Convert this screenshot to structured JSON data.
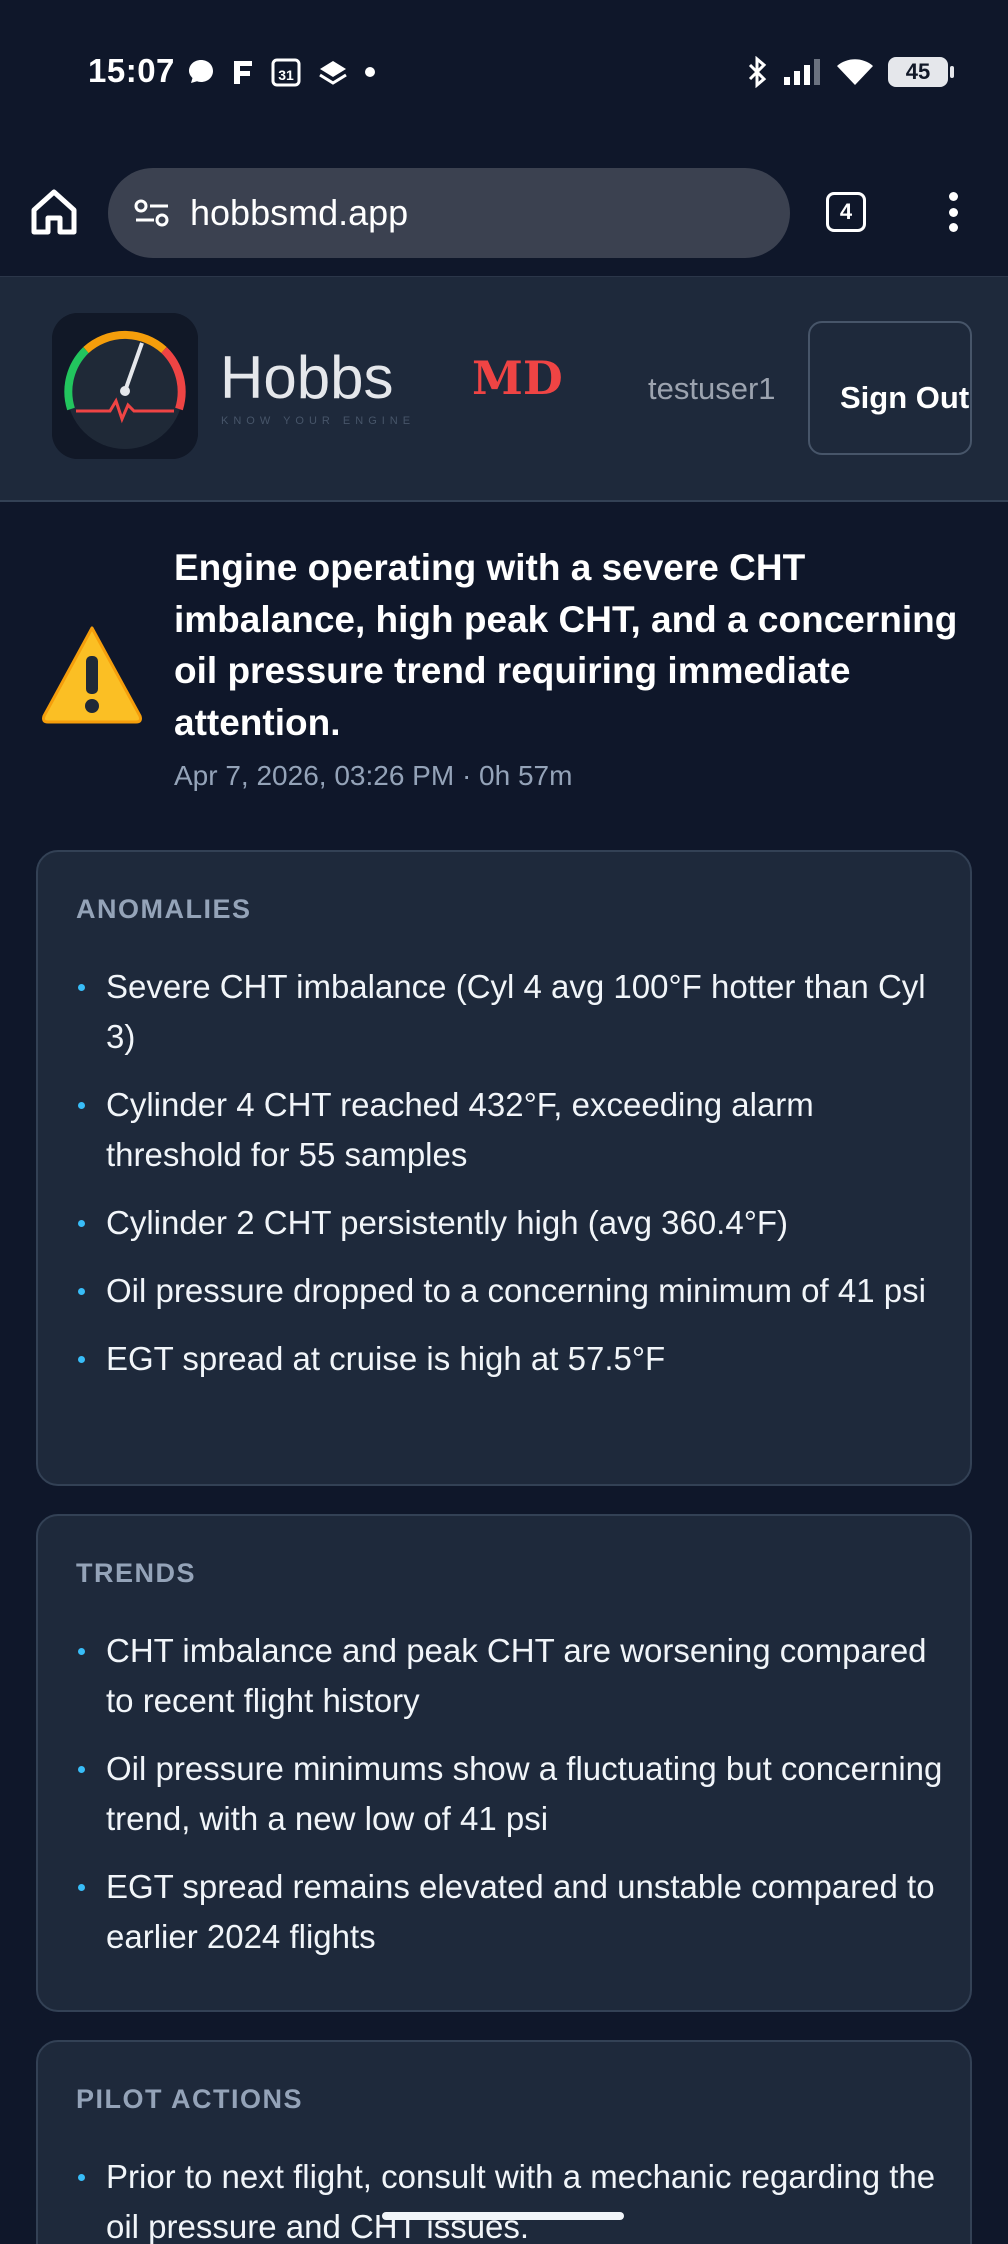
{
  "status_bar": {
    "time": "15:07",
    "battery": "45",
    "left_icons": [
      "messenger-icon",
      "f-app-icon",
      "calendar-icon",
      "stack-icon",
      "dot-icon"
    ],
    "right_icons": [
      "bluetooth-icon",
      "signal-icon",
      "wifi-icon",
      "battery-icon"
    ],
    "calendar_day": "31"
  },
  "browser": {
    "url": "hobbsmd.app",
    "tab_count": "4"
  },
  "header": {
    "brand_name": "Hobbs",
    "brand_suffix": "MD",
    "tagline": "KNOW YOUR ENGINE",
    "username": "testuser1",
    "sign_out_label": "Sign Out"
  },
  "summary": {
    "headline": "Engine operating with a severe CHT imbalance, high peak CHT, and a concerning oil pressure trend requiring immediate attention.",
    "meta": "Apr 7, 2026, 03:26 PM · 0h 57m"
  },
  "sections": {
    "anomalies": {
      "title": "ANOMALIES",
      "items": [
        "Severe CHT imbalance (Cyl 4 avg 100°F hotter than Cyl 3)",
        "Cylinder 4 CHT reached 432°F, exceeding alarm threshold for 55 samples",
        "Cylinder 2 CHT persistently high (avg 360.4°F)",
        "Oil pressure dropped to a concerning minimum of 41 psi",
        "EGT spread at cruise is high at 57.5°F"
      ]
    },
    "trends": {
      "title": "TRENDS",
      "items": [
        "CHT imbalance and peak CHT are worsening compared to recent flight history",
        "Oil pressure minimums show a fluctuating but concerning trend, with a new low of 41 psi",
        "EGT spread remains elevated and unstable compared to earlier 2024 flights"
      ]
    },
    "pilot_actions": {
      "title": "PILOT ACTIONS",
      "items": [
        "Prior to next flight, consult with a mechanic regarding the oil pressure and CHT issues."
      ]
    }
  },
  "colors": {
    "background": "#0f172a",
    "card": "#1e293b",
    "accent_bullet": "#38bdf8",
    "brand_red": "#ef4444"
  }
}
